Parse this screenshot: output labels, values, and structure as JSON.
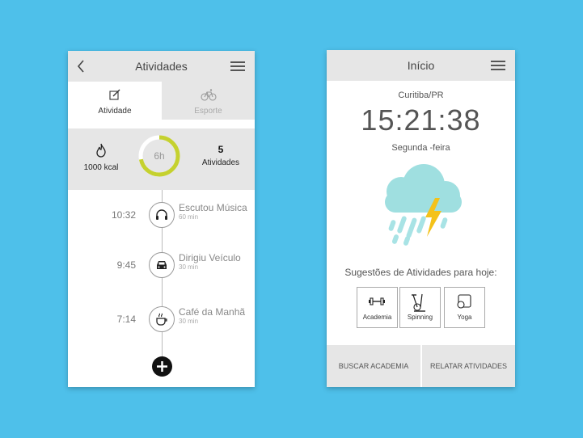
{
  "left_screen": {
    "title": "Atividades",
    "tabs": [
      {
        "label": "Atividade",
        "icon": "edit-icon",
        "active": true
      },
      {
        "label": "Esporte",
        "icon": "bicycle-icon",
        "active": false
      }
    ],
    "stats": {
      "calories": "1000 kcal",
      "ring_label": "6h",
      "ring_progress": 0.72,
      "activities_count": "5",
      "activities_label": "Atividades"
    },
    "timeline": [
      {
        "time": "10:32",
        "name": "Escutou Música",
        "duration": "60 min",
        "icon": "headphones-icon"
      },
      {
        "time": "9:45",
        "name": "Dirigiu Veículo",
        "duration": "30 min",
        "icon": "car-icon"
      },
      {
        "time": "7:14",
        "name": "Café da Manhã",
        "duration": "30 min",
        "icon": "coffee-icon"
      }
    ]
  },
  "right_screen": {
    "title": "Início",
    "city": "Curitiba/PR",
    "time": "15:21:38",
    "weekday": "Segunda -feira",
    "weather_icon": "storm-cloud-icon",
    "suggestions_title": "Sugestões de Atividades para hoje:",
    "suggestions": [
      {
        "label": "Academia",
        "icon": "dumbbell-icon"
      },
      {
        "label": "Spinning",
        "icon": "spinning-bike-icon"
      },
      {
        "label": "Yoga",
        "icon": "yoga-mat-icon"
      }
    ],
    "buttons": {
      "find_gym": "BUSCAR ACADEMIA",
      "report": "RELATAR ATIVIDADES"
    }
  },
  "colors": {
    "background": "#4ec0ea",
    "ring": "#c5d12f",
    "cloud": "#9fdfe0",
    "lightning": "#f4c21a"
  }
}
